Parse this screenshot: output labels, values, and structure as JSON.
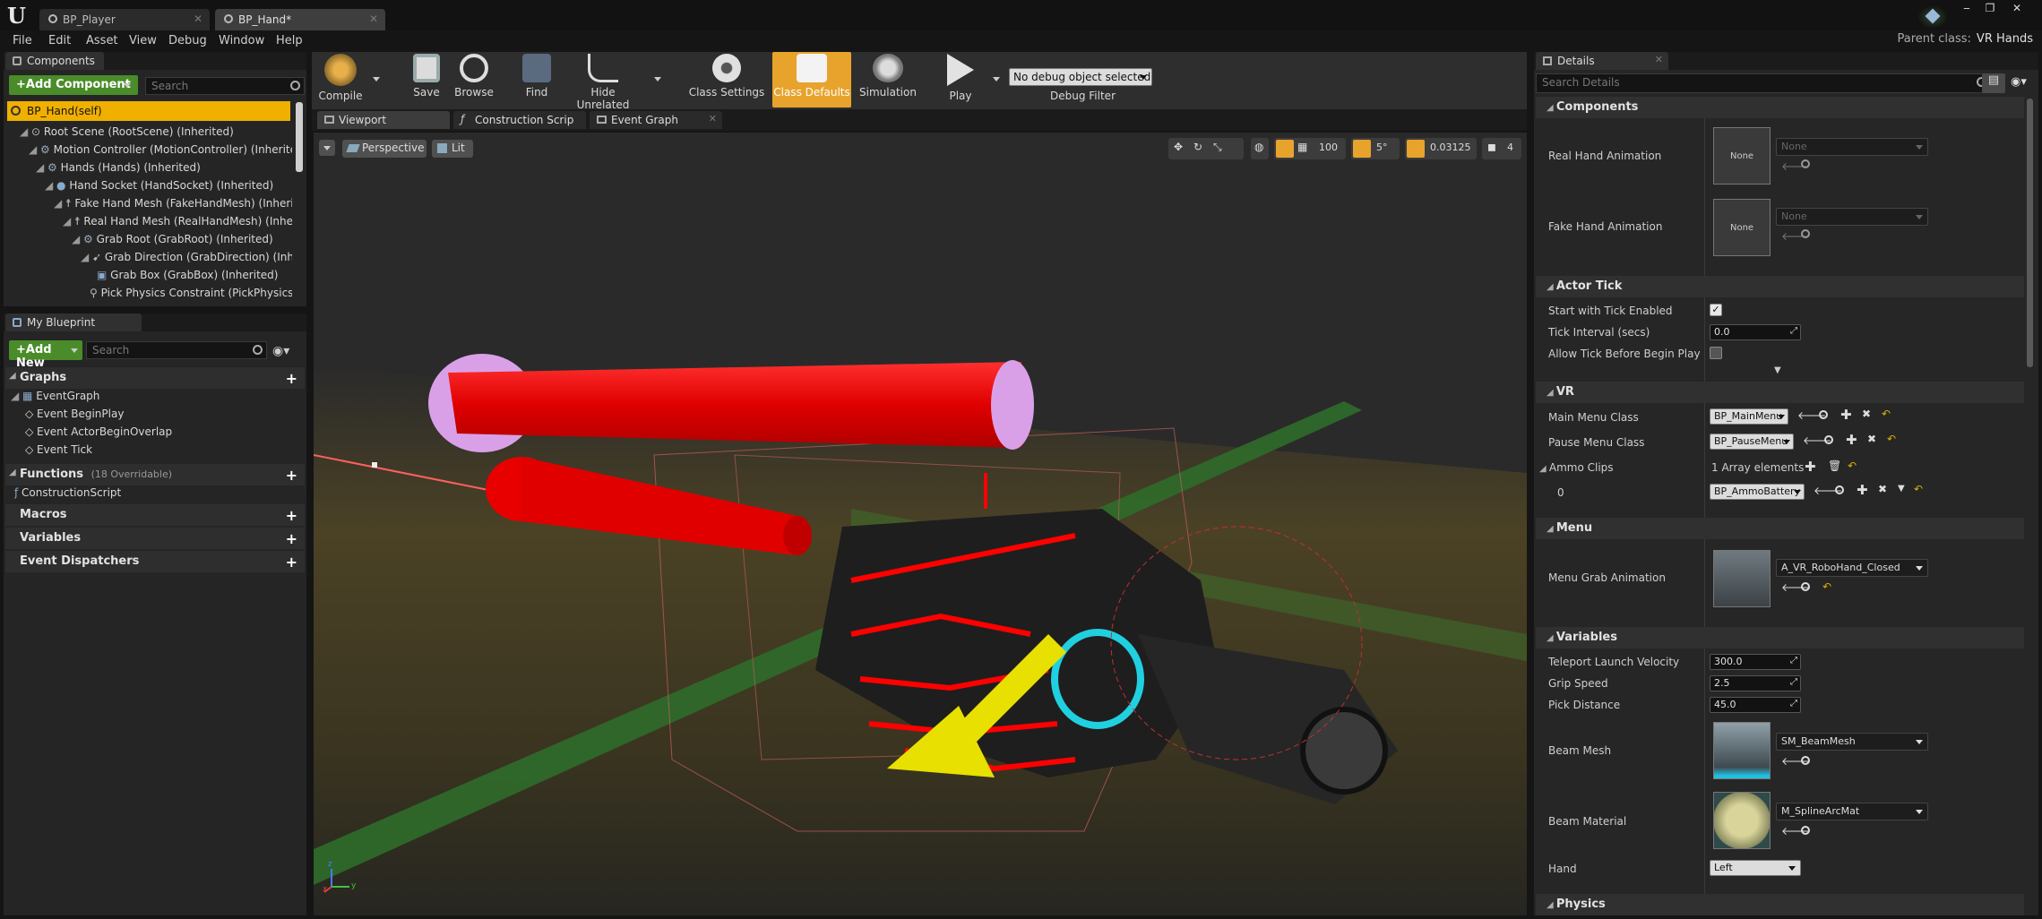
{
  "window": {
    "logo": "U",
    "tabs": [
      {
        "label": "BP_Player"
      },
      {
        "label": "BP_Hand*"
      }
    ],
    "parent_class_label": "Parent class:",
    "parent_class_value": "VR Hands",
    "controls": {
      "minimize": "‒",
      "maximize": "❐",
      "close": "✕"
    }
  },
  "menubar": [
    "File",
    "Edit",
    "Asset",
    "View",
    "Debug",
    "Window",
    "Help"
  ],
  "components_panel": {
    "tab": "Components",
    "add_button": "+Add Component",
    "search_placeholder": "Search",
    "self_item": "BP_Hand(self)",
    "tree": [
      "Root Scene (RootScene) (Inherited)",
      "Motion Controller (MotionController) (Inherited)",
      "Hands (Hands) (Inherited)",
      "Hand Socket (HandSocket) (Inherited)",
      "Fake Hand Mesh (FakeHandMesh) (Inherited)",
      "Real Hand Mesh (RealHandMesh) (Inherited)",
      "Grab Root (GrabRoot) (Inherited)",
      "Grab Direction (GrabDirection) (Inherited)",
      "Grab Box (GrabBox) (Inherited)",
      "Pick Physics Constraint (PickPhysicsConstraint)"
    ]
  },
  "my_blueprint": {
    "tab": "My Blueprint",
    "add_button": "+Add New",
    "search_placeholder": "Search",
    "graphs_label": "Graphs",
    "graph_name": "EventGraph",
    "events": [
      "Event BeginPlay",
      "Event ActorBeginOverlap",
      "Event Tick"
    ],
    "functions_label": "Functions",
    "functions_count": "(18 Overridable)",
    "functions": [
      "ConstructionScript"
    ],
    "macros_label": "Macros",
    "variables_label": "Variables",
    "dispatchers_label": "Event Dispatchers"
  },
  "toolbar": {
    "compile": "Compile",
    "save": "Save",
    "browse": "Browse",
    "find": "Find",
    "hide_unrelated": "Hide Unrelated",
    "class_settings": "Class Settings",
    "class_defaults": "Class Defaults",
    "simulation": "Simulation",
    "play": "Play",
    "debug_object": "No debug object selected",
    "debug_filter": "Debug Filter"
  },
  "editor_tabs": [
    "Viewport",
    "Construction Scrip",
    "Event Graph"
  ],
  "viewport": {
    "perspective": "Perspective",
    "lit": "Lit",
    "grid_size": "100",
    "rotation_snap": "5°",
    "scale_snap": "0.03125",
    "camera_speed": "4",
    "axis_x": "x",
    "axis_y": "y",
    "axis_z": "z"
  },
  "details": {
    "tab": "Details",
    "search_placeholder": "Search Details",
    "none_thumb": "None",
    "sections": {
      "components": "Components",
      "actor_tick": "Actor Tick",
      "vr": "VR",
      "menu": "Menu",
      "variables": "Variables",
      "physics": "Physics"
    },
    "real_hand_animation": {
      "label": "Real Hand Animation",
      "value": "None"
    },
    "fake_hand_animation": {
      "label": "Fake Hand Animation",
      "value": "None"
    },
    "start_with_tick": {
      "label": "Start with Tick Enabled",
      "checked": true
    },
    "tick_interval": {
      "label": "Tick Interval (secs)",
      "value": "0.0"
    },
    "allow_tick_before_begin": {
      "label": "Allow Tick Before Begin Play",
      "checked": false
    },
    "main_menu_class": {
      "label": "Main Menu Class",
      "value": "BP_MainMenu"
    },
    "pause_menu_class": {
      "label": "Pause Menu Class",
      "value": "BP_PauseMenu"
    },
    "ammo_clips": {
      "label": "Ammo Clips",
      "value": "1 Array elements",
      "index": "0",
      "element": "BP_AmmoBattery"
    },
    "menu_grab_animation": {
      "label": "Menu Grab Animation",
      "value": "A_VR_RoboHand_Closed"
    },
    "teleport_launch_velocity": {
      "label": "Teleport Launch Velocity",
      "value": "300.0"
    },
    "grip_speed": {
      "label": "Grip Speed",
      "value": "2.5"
    },
    "pick_distance": {
      "label": "Pick Distance",
      "value": "45.0"
    },
    "beam_mesh": {
      "label": "Beam Mesh",
      "value": "SM_BeamMesh"
    },
    "beam_material": {
      "label": "Beam Material",
      "value": "M_SplineArcMat"
    },
    "hand": {
      "label": "Hand",
      "value": "Left"
    }
  },
  "colors": {
    "accent_orange": "#e8a32c",
    "add_green": "#4a8c2a",
    "selection_yellow": "#f0b000",
    "viewport_bg": "#2a2a2a"
  }
}
